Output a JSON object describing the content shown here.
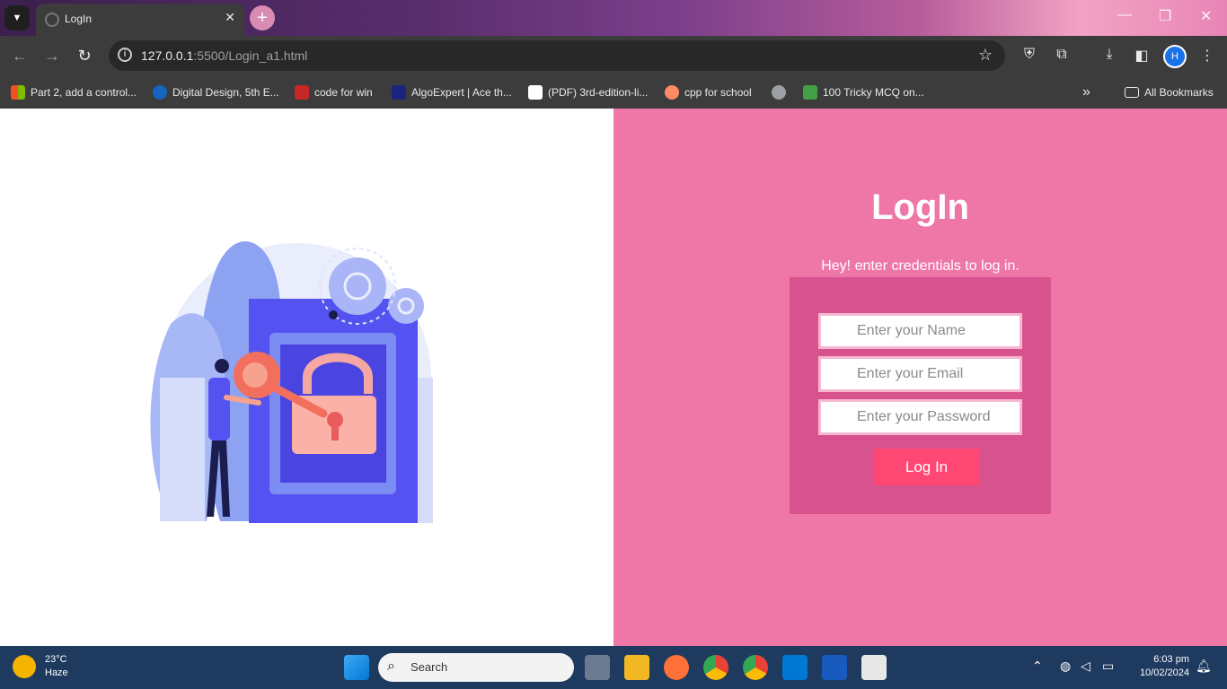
{
  "browser": {
    "tab_title": "LogIn",
    "url_host": "127.0.0.1",
    "url_rest": ":5500/Login_a1.html",
    "profile_initial": "H"
  },
  "bookmarks": [
    {
      "label": "Part 2, add a control...",
      "icon": "microsoft-icon",
      "color": "#f25022"
    },
    {
      "label": "Digital Design, 5th E...",
      "icon": "site-icon",
      "color": "#1565c0"
    },
    {
      "label": "code for win",
      "icon": "site-icon",
      "color": "#c62828"
    },
    {
      "label": "AlgoExpert | Ace th...",
      "icon": "algoexpert-icon",
      "color": "#1a237e"
    },
    {
      "label": "(PDF) 3rd-edition-li...",
      "icon": "academia-icon",
      "color": "#ffffff"
    },
    {
      "label": "cpp for school",
      "icon": "site-icon",
      "color": "#ff8a65"
    },
    {
      "label": "",
      "icon": "globe-icon",
      "color": "#9aa0a6"
    },
    {
      "label": "100 Tricky MCQ on...",
      "icon": "cb-icon",
      "color": "#43a047"
    }
  ],
  "all_bookmarks": "All Bookmarks",
  "login": {
    "heading": "LogIn",
    "subtitle": "Hey! enter credentials to log in.",
    "name_placeholder": "Enter your Name",
    "email_placeholder": "Enter your Email",
    "password_placeholder": "Enter your Password",
    "button": "Log In"
  },
  "taskbar": {
    "temperature": "23°C",
    "weather": "Haze",
    "search": "Search",
    "time": "6:03 pm",
    "date": "10/02/2024"
  }
}
